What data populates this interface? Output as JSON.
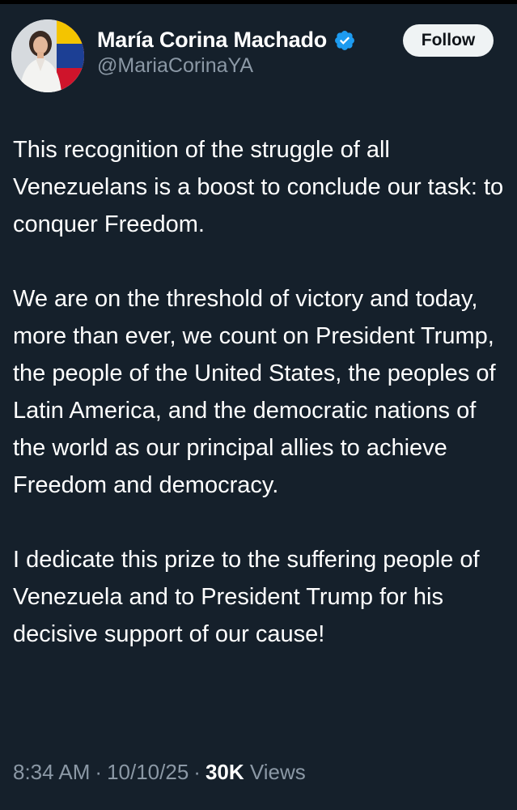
{
  "author": {
    "name": "María Corina Machado",
    "handle": "@MariaCorinaYA",
    "verified": true
  },
  "follow_button_label": "Follow",
  "tweet": {
    "paragraphs": [
      "This recognition of the struggle of all Venezuelans is a boost to conclude our task: to conquer Freedom.",
      "We are on the threshold of victory and today, more than ever, we count on President Trump, the people of the United States, the peoples of Latin America, and the democratic nations of the world as our principal allies to achieve Freedom and democracy.",
      "I dedicate this prize to the suffering people of Venezuela and to President Trump for his decisive support of our cause!"
    ]
  },
  "meta": {
    "time": "8:34 AM",
    "date": "10/10/25",
    "separator": "·",
    "views_count": "30K",
    "views_label": "Views"
  },
  "colors": {
    "background": "#15202b",
    "secondary_text": "#8b98a5",
    "verified_badge": "#1d9bf0",
    "follow_button_bg": "#eff3f4"
  },
  "icons": {
    "verified": "verified-badge-icon"
  }
}
